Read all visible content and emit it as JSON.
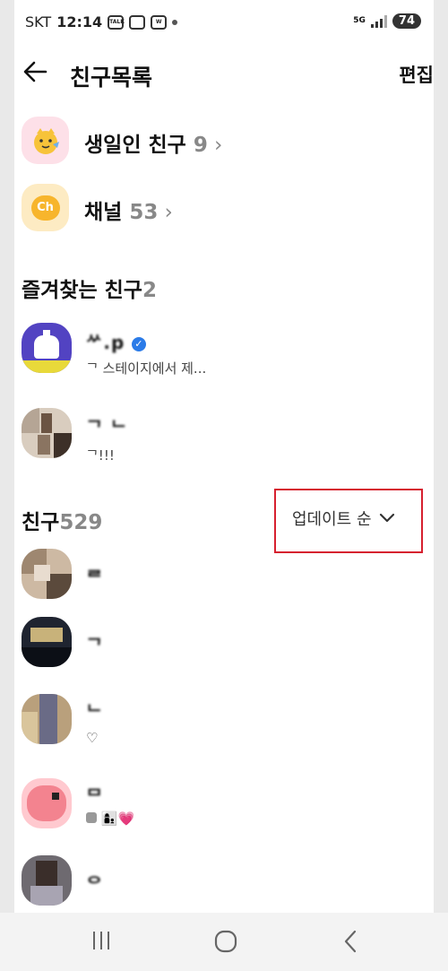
{
  "status_bar": {
    "carrier": "SKT",
    "time": "12:14",
    "notif_icons": [
      "kakaotalk-icon",
      "screen-icon",
      "webtoon-icon"
    ],
    "network": "5G",
    "battery": "74"
  },
  "header": {
    "title": "친구목록",
    "edit_label": "편집"
  },
  "shortcuts": [
    {
      "label": "생일인 친구",
      "count": "9",
      "icon": "birthday-icon"
    },
    {
      "label": "채널",
      "count": "53",
      "icon": "channel-icon",
      "badge": "Ch"
    }
  ],
  "favorites": {
    "label": "즐겨찾는 친구",
    "count": "2",
    "items": [
      {
        "name": "ᄽ.p",
        "status": "ᄀ 스테이지에서 제...",
        "verified": true
      },
      {
        "name": "ᄀ ᄂ",
        "status": "ᄀ!!!"
      }
    ]
  },
  "friends": {
    "label": "친구",
    "count": "529",
    "sort_label": "업데이트 순",
    "items": [
      {
        "name": "ᄅ",
        "status": ""
      },
      {
        "name": "ᄀ",
        "status": ""
      },
      {
        "name": "ᄂ",
        "status": "♡"
      },
      {
        "name": "ᄆ",
        "status": ""
      },
      {
        "name": "ᄋ",
        "status": ""
      }
    ]
  },
  "nav": {
    "recent_icon": "recent-apps-icon",
    "home_icon": "home-icon",
    "back_icon": "back-icon"
  }
}
